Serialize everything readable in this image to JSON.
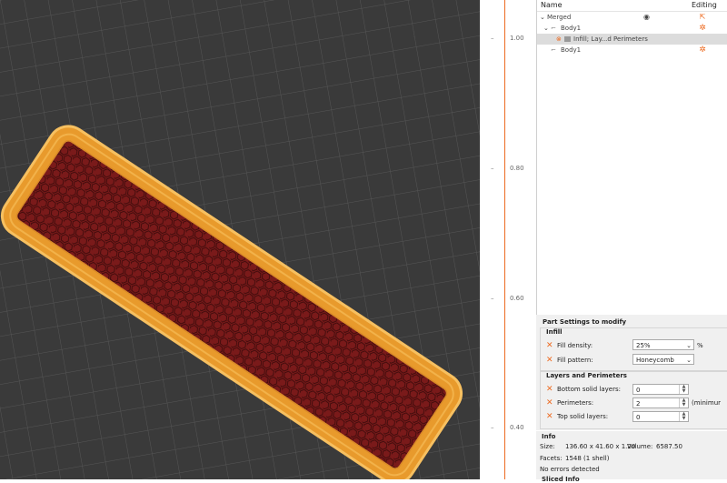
{
  "colors": {
    "accent": "#ED6B21",
    "viewport_bg": "#3a3a3a",
    "grid": "#555555",
    "perimeter": "#F5A623",
    "infill": "#8B1A1A"
  },
  "slider": {
    "ticks": [
      "1.00",
      "0.80",
      "0.60",
      "0.40"
    ]
  },
  "object_list": {
    "headers": {
      "name": "Name",
      "editing": "Editing"
    },
    "rows": [
      {
        "label": "Merged",
        "icon": "chevron-down-icon",
        "extra_icon": "eye-icon",
        "edit_icon": "external-edit-icon"
      },
      {
        "label": "Body1",
        "icon": "part-icon",
        "edit_icon": "gear-icon"
      },
      {
        "label": "Infill; Lay...d Perimeters",
        "icon": "settings-icon"
      },
      {
        "label": "Body1",
        "icon": "part-icon",
        "edit_icon": "gear-icon"
      }
    ]
  },
  "part_settings": {
    "title": "Part Settings to modify",
    "infill": {
      "title": "Infill",
      "fill_density": {
        "label": "Fill density:",
        "value": "25%",
        "unit": "%"
      },
      "fill_pattern": {
        "label": "Fill pattern:",
        "value": "Honeycomb"
      }
    },
    "layers": {
      "title": "Layers and Perimeters",
      "bottom": {
        "label": "Bottom solid layers:",
        "value": "0"
      },
      "perimeters": {
        "label": "Perimeters:",
        "value": "2",
        "note": "(minimur"
      },
      "top": {
        "label": "Top solid layers:",
        "value": "0"
      }
    }
  },
  "info": {
    "title": "Info",
    "size_label": "Size:",
    "size_value": "136.60 x 41.60 x 1.20",
    "volume_label": "Volume:",
    "volume_value": "6587.50",
    "facets_label": "Facets:",
    "facets_value": "1548 (1 shell)",
    "errors": "No errors detected",
    "sliced_title": "Sliced Info"
  }
}
